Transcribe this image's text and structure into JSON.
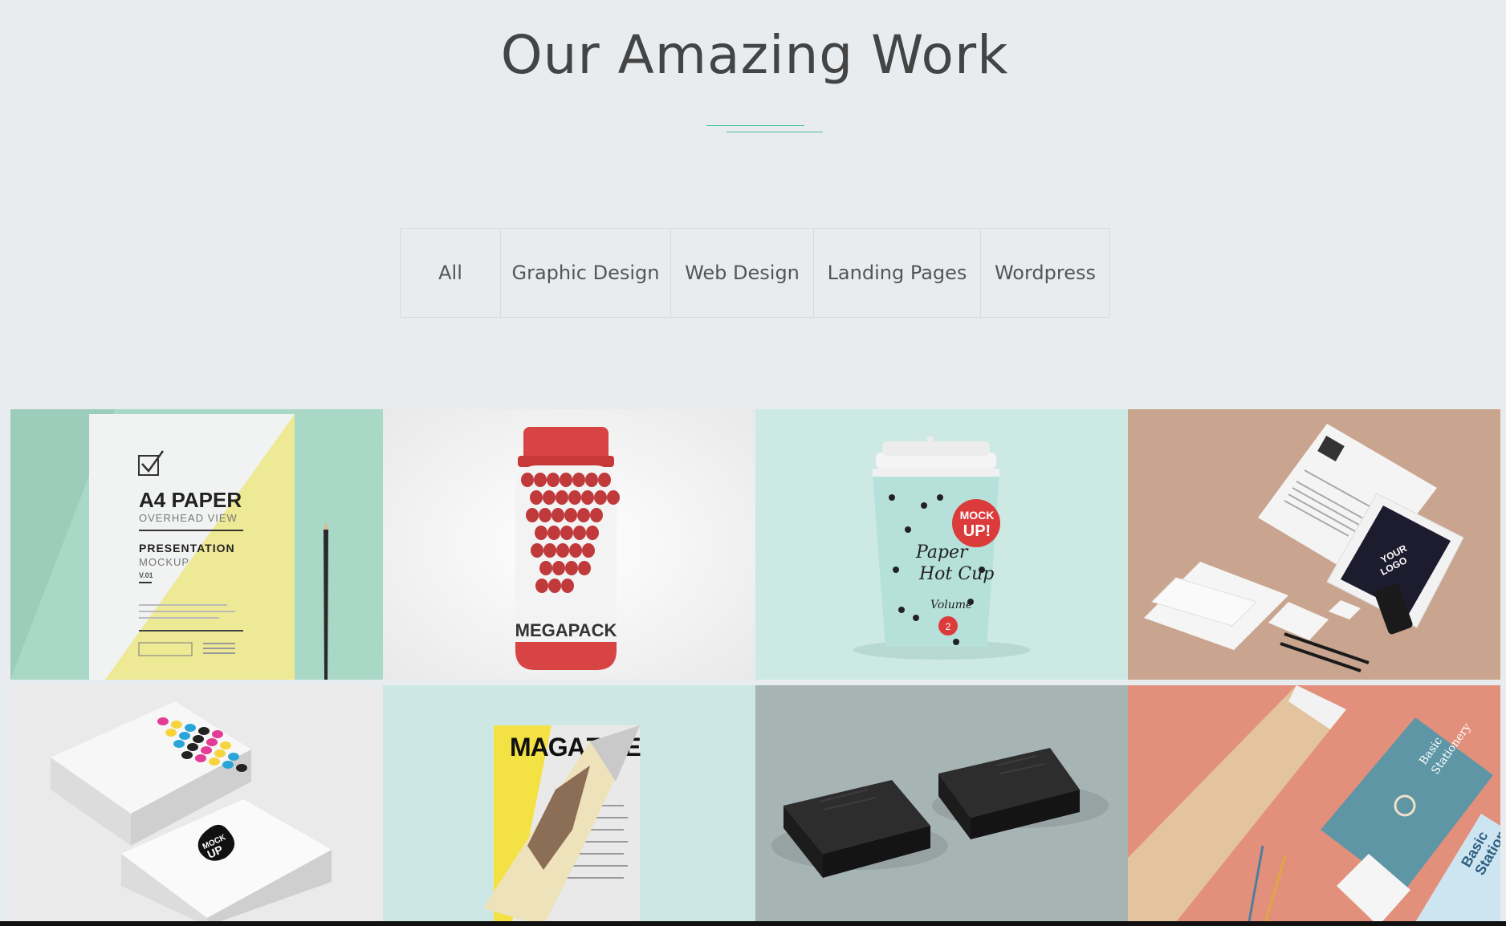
{
  "section": {
    "title": "Our Amazing Work"
  },
  "filters": [
    {
      "label": "All",
      "active": true
    },
    {
      "label": "Graphic Design"
    },
    {
      "label": "Web Design"
    },
    {
      "label": "Landing Pages"
    },
    {
      "label": "Wordpress"
    }
  ],
  "colors": {
    "accent": "#48c2a0",
    "background": "#e9ecef",
    "text": "#444444"
  },
  "portfolio": {
    "items": [
      {
        "name": "a4-paper-mockup",
        "lines": [
          "A4 PAPER",
          "OVERHEAD VIEW",
          "PRESENTATION",
          "MOCKUP",
          "V.01"
        ]
      },
      {
        "name": "megapack-bottle-mockup",
        "lines": [
          "MEGAPACK"
        ]
      },
      {
        "name": "paper-hot-cup-mockup",
        "lines": [
          "MOCK",
          "UP!",
          "Paper",
          "Hot Cup",
          "Volume",
          "2"
        ]
      },
      {
        "name": "stationery-branding-mockup",
        "lines": [
          "YOUR",
          "LOGO"
        ]
      },
      {
        "name": "business-cards-mockup",
        "lines": [
          "MOCK",
          "UP"
        ]
      },
      {
        "name": "magazine-mockup",
        "lines": [
          "MAGAZINE"
        ]
      },
      {
        "name": "black-business-cards-mockup",
        "lines": []
      },
      {
        "name": "basic-stationery-mockup",
        "lines": [
          "Basic",
          "Stationery"
        ]
      }
    ]
  }
}
